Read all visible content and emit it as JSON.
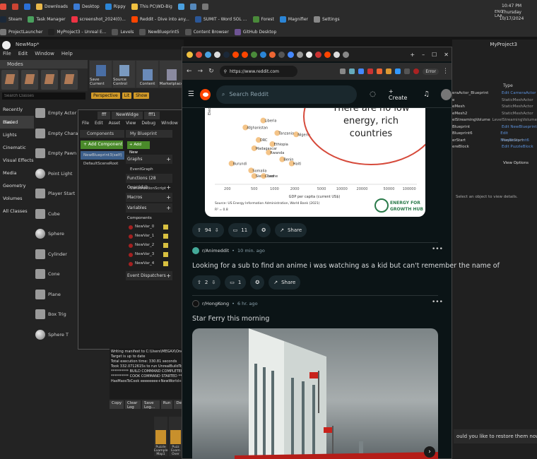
{
  "taskbar": {
    "row1": [
      {
        "label": "",
        "color": "#e34d3c"
      },
      {
        "label": "",
        "color": "#c43"
      },
      {
        "label": "",
        "color": "#2a6fd6"
      },
      {
        "label": "Downloads",
        "color": "#e9b84a"
      },
      {
        "label": "Desktop",
        "color": "#3b7bd4"
      },
      {
        "label": "Rippy",
        "color": "#2b85d6"
      },
      {
        "label": "This PC\\WD-Big",
        "color": "#f0c040"
      },
      {
        "label": "",
        "color": "#4aa0e0"
      },
      {
        "label": "",
        "color": "#58b"
      },
      {
        "label": "",
        "color": "#777"
      }
    ],
    "row2": [
      {
        "label": "Steam",
        "color": "#1b2838"
      },
      {
        "label": "Task Manager",
        "color": "#4aa05e"
      },
      {
        "label": "screenshot_2024(0)...",
        "color": "#e34"
      },
      {
        "label": "Reddit - Dive into any...",
        "color": "#ff4500"
      },
      {
        "label": "SUMIT - Word SOL ...",
        "color": "#2b5797"
      },
      {
        "label": "Forest",
        "color": "#4a8a3a"
      },
      {
        "label": "Magnifier",
        "color": "#2b85d6"
      },
      {
        "label": "Settings",
        "color": "#888"
      }
    ],
    "row3": [
      {
        "label": "ProjectLauncher",
        "color": "#777"
      },
      {
        "label": "MyProject3 - Unreal E...",
        "color": "#222"
      },
      {
        "label": "Levels",
        "color": "#555"
      },
      {
        "label": "NewBlueprint5",
        "color": "#555"
      },
      {
        "label": "Content Browser",
        "color": "#555"
      },
      {
        "label": "GitHub Desktop",
        "color": "#6e5494"
      }
    ],
    "clock": {
      "time": "10:47 PM",
      "day": "Thursday",
      "date": "10/17/2024",
      "lang": "ENG",
      "region": "LAA"
    }
  },
  "ue": {
    "title_tab": "NewMap*",
    "menu": [
      "File",
      "Edit",
      "Window",
      "Help"
    ],
    "modes_title": "Modes",
    "search_placeholder": "Search Classes",
    "categories": [
      "Recently Placed",
      "Basic",
      "Lights",
      "Cinematic",
      "Visual Effects",
      "Media",
      "Geometry",
      "Volumes",
      "All Classes"
    ],
    "selected_category": "Basic",
    "placeables": [
      {
        "label": "Empty Actor",
        "shape": "cube"
      },
      {
        "label": "Empty Character",
        "shape": "cube"
      },
      {
        "label": "Empty Pawn",
        "shape": "cube"
      },
      {
        "label": "Point Light",
        "shape": "sphere"
      },
      {
        "label": "Player Start",
        "shape": "cube"
      },
      {
        "label": "Cube",
        "shape": "cube"
      },
      {
        "label": "Sphere",
        "shape": "sphere"
      },
      {
        "label": "Cylinder",
        "shape": "cube"
      },
      {
        "label": "Cone",
        "shape": "cube"
      },
      {
        "label": "Plane",
        "shape": "cube"
      },
      {
        "label": "Box Trig",
        "shape": "cube"
      },
      {
        "label": "Sphere T",
        "shape": "sphere"
      }
    ],
    "toolbar": [
      "Save Current",
      "Source Control",
      "Content",
      "Marketplace"
    ],
    "viewport_buttons": [
      "Perspective",
      "Lit",
      "Show"
    ],
    "blueprint": {
      "tabs": [
        "fff",
        "NewWidge",
        "fff1"
      ],
      "menu": [
        "File",
        "Edit",
        "Asset",
        "View",
        "Debug",
        "Window",
        "Help"
      ],
      "components_title": "Components",
      "add_component": "+ Add Component",
      "components": [
        "NewBlueprint3(self)",
        "DefaultSceneRoot"
      ],
      "mybp_title": "My Blueprint",
      "add_new": "+ Add New",
      "sections": [
        {
          "title": "Graphs",
          "items": [
            "EventGraph"
          ]
        },
        {
          "title": "Functions (28 Overridab",
          "items": [
            "ConstructionScript"
          ]
        },
        {
          "title": "Macros",
          "items": []
        },
        {
          "title": "Variables",
          "items": []
        }
      ],
      "components_group": "Components",
      "variables": [
        "NewVar_0",
        "NewVar_1",
        "NewVar_2",
        "NewVar_3",
        "NewVar_4"
      ],
      "event_dispatchers": "Event Dispatchers"
    },
    "log": {
      "lines": [
        "Writing manifest to C:\\Users\\MEGAX\\OneDrive",
        "Target is up to date",
        "Total execution time: 330.81 seconds",
        "Took 332.0712615s to run UnrealBuildTool.exe",
        "********** BUILD COMMAND COMPLETED **********",
        "********** COOK COMMAND STARTED **********",
        "HasMaosToCook eeeeeeee+NewWorld+PuzzleE"
      ],
      "buttons": [
        "Copy",
        "Clear Log",
        "Save Log...",
        "Run",
        "De"
      ]
    },
    "thumbs": [
      "Puzzle Example Map1",
      "Puzz Exam Over"
    ]
  },
  "right_panel": {
    "project_title": "MyProject3",
    "type_header": "Type",
    "rows": [
      {
        "name": "eraActor_Blueprint",
        "type": "Edit CameraActor",
        "link": true
      },
      {
        "name": "e",
        "type": "StaticMeshActor",
        "link": false
      },
      {
        "name": "eMesh",
        "type": "StaticMeshActor",
        "link": false
      },
      {
        "name": "eMesh2",
        "type": "StaticMeshActor",
        "link": false
      },
      {
        "name": "elStreamingVolume",
        "type": "LevelStreamingVolume",
        "link": false
      },
      {
        "name": "Blueprint",
        "type": "Edit NewBlueprint",
        "link": true
      },
      {
        "name": "Blueprint6",
        "type": "Edit NewBlueprint6",
        "link": true
      },
      {
        "name": "erStart",
        "type": "PlayerStart",
        "link": false
      },
      {
        "name": "ereBlock",
        "type": "Edit PuzzleBlock",
        "link": true
      }
    ],
    "view_options": "View Options",
    "select_msg": "Select an object to view details.",
    "restore_msg": "ould you like to restore them now?"
  },
  "browser": {
    "url": "https://www.reddit.com",
    "error_label": "Error",
    "search_placeholder": "Search Reddit",
    "create_label": "Create"
  },
  "post1": {
    "upvotes": "94",
    "comments": "11",
    "share": "Share",
    "chart_title": "There are no low energy, rich countries",
    "x_axis_label": "GDP per capita (current US$)",
    "source": "Source: US Energy Information Administration, World Bank (2021)",
    "r2": "R² = 0.8",
    "logo_text": "ENERGY FOR GROWTH HUB"
  },
  "post2": {
    "subreddit": "r/Animeddit",
    "time": "10 min. ago",
    "title": "Looking for a sub to find an anime i was watching as a kid but can't remember the name of",
    "upvotes": "2",
    "comments": "1",
    "share": "Share"
  },
  "post3": {
    "subreddit": "r/HongKong",
    "time": "6 hr. ago",
    "title": "Star Ferry this morning"
  },
  "chart_data": {
    "type": "scatter",
    "title": "There are no low energy, rich countries",
    "xlabel": "GDP per capita (current US$)",
    "x_scale": "log",
    "x_ticks": [
      "200",
      "500",
      "1000",
      "2000",
      "5000",
      "10000",
      "20000",
      "50000",
      "100000"
    ],
    "points": [
      {
        "label": "Afghanistan",
        "x": 370,
        "y": 4.1
      },
      {
        "label": "Liberia",
        "x": 680,
        "y": 4.6
      },
      {
        "label": "Tanzania",
        "x": 1100,
        "y": 3.7
      },
      {
        "label": "Nigeria",
        "x": 2100,
        "y": 3.6
      },
      {
        "label": "DRC",
        "x": 580,
        "y": 3.2
      },
      {
        "label": "Ethiopia",
        "x": 930,
        "y": 2.9
      },
      {
        "label": "Madagascar",
        "x": 500,
        "y": 2.6
      },
      {
        "label": "Rwanda",
        "x": 820,
        "y": 2.3
      },
      {
        "label": "Benin",
        "x": 1300,
        "y": 1.8
      },
      {
        "label": "Haiti",
        "x": 1800,
        "y": 1.5
      },
      {
        "label": "Burundi",
        "x": 230,
        "y": 1.5
      },
      {
        "label": "Somalia",
        "x": 450,
        "y": 1.0
      },
      {
        "label": "Sierra Leone",
        "x": 500,
        "y": 0.6
      },
      {
        "label": "Chad",
        "x": 690,
        "y": 0.6
      }
    ]
  }
}
